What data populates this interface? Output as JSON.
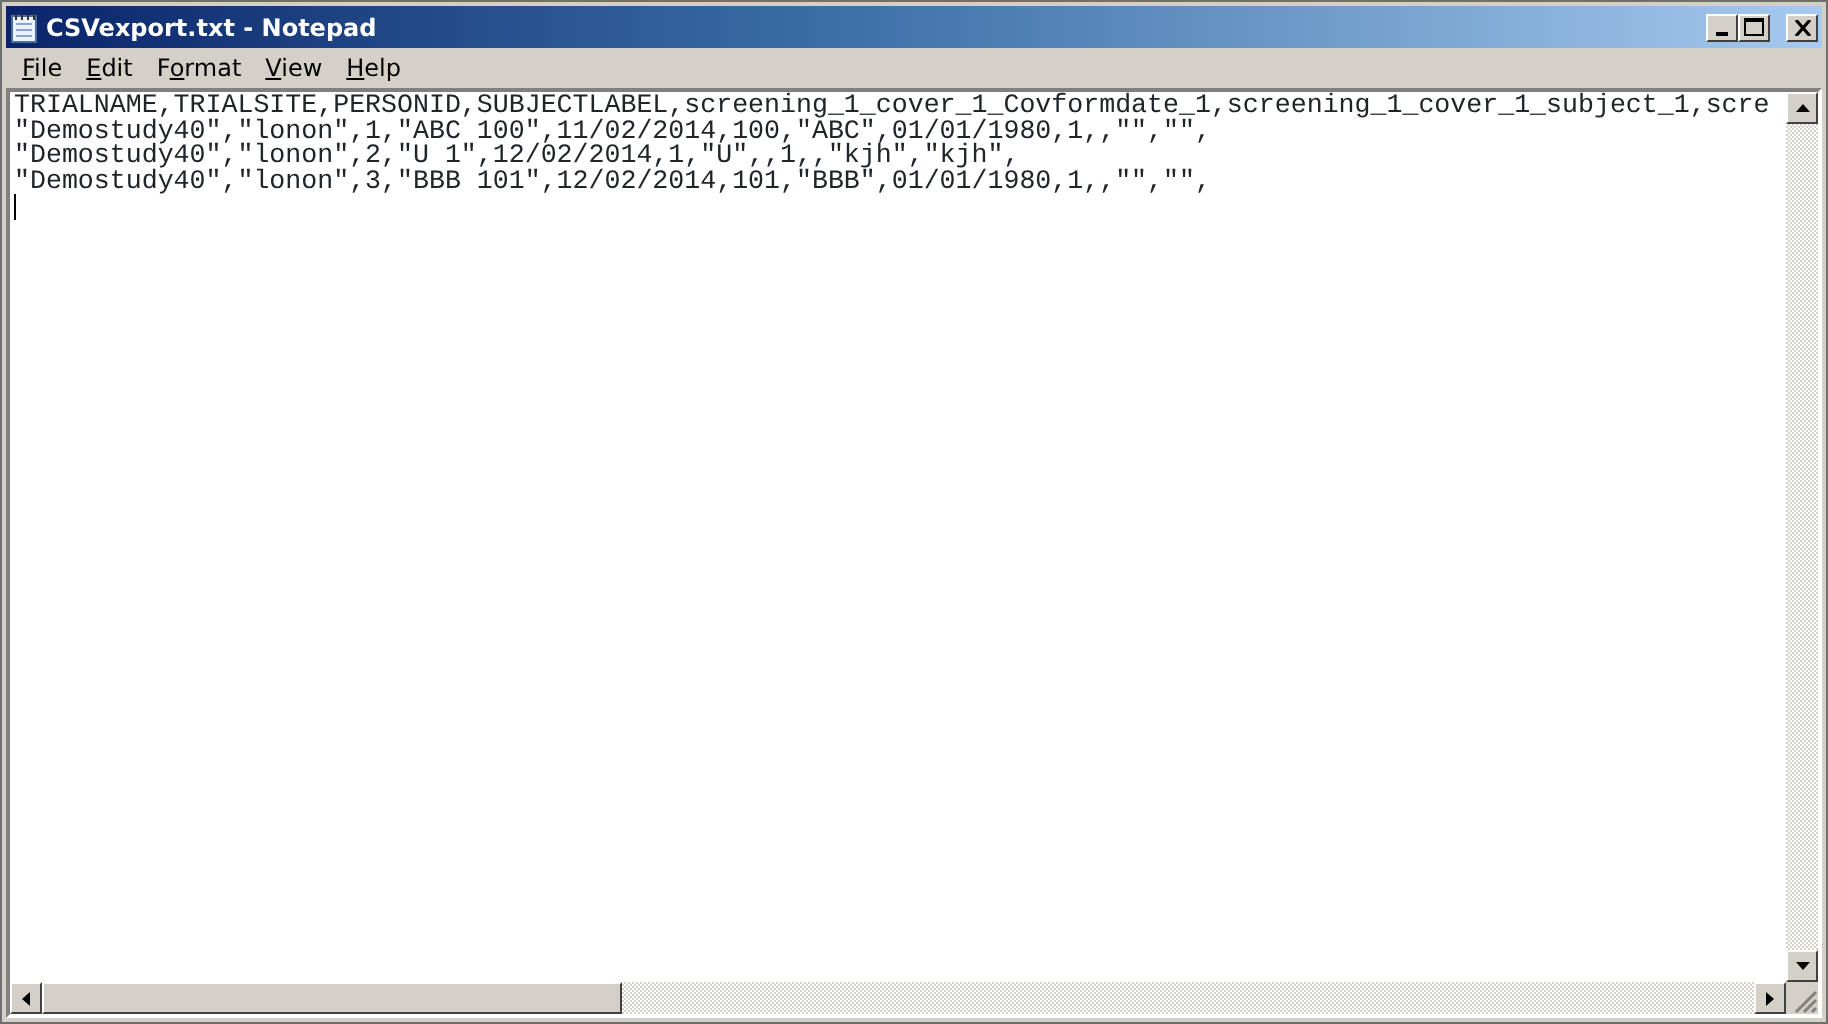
{
  "window": {
    "title": "CSVexport.txt - Notepad"
  },
  "menu": [
    {
      "key": "F",
      "tail": "ile"
    },
    {
      "key": "E",
      "tail": "dit"
    },
    {
      "lead": "F",
      "key": "o",
      "tail": "rmat"
    },
    {
      "key": "V",
      "tail": "iew"
    },
    {
      "key": "H",
      "tail": "elp"
    }
  ],
  "lines": [
    "TRIALNAME,TRIALSITE,PERSONID,SUBJECTLABEL,screening_1_cover_1_Covformdate_1,screening_1_cover_1_subject_1,scre",
    "\"Demostudy40\",\"lonon\",1,\"ABC 100\",11/02/2014,100,\"ABC\",01/01/1980,1,,\"\",\"\",",
    "\"Demostudy40\",\"lonon\",2,\"U 1\",12/02/2014,1,\"U\",,1,,\"kjh\",\"kjh\",",
    "\"Demostudy40\",\"lonon\",3,\"BBB 101\",12/02/2014,101,\"BBB\",01/01/1980,1,,\"\",\"\","
  ]
}
